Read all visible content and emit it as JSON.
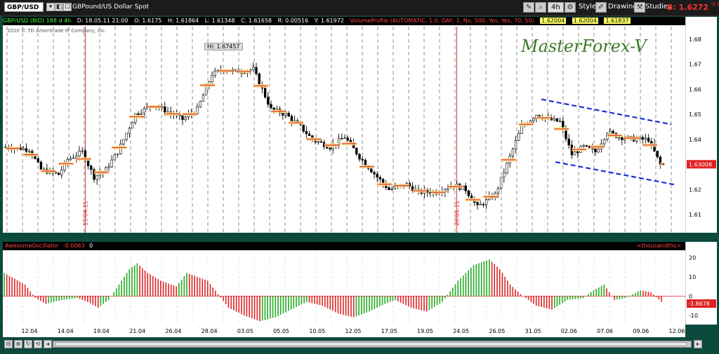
{
  "toolbar": {
    "symbol": "GBP/USD",
    "description": "GBPound/US Dollar Spot",
    "timeframe": "4h",
    "style_label": "Style",
    "drawings_label": "Drawings",
    "studies_label": "Studies",
    "bid_text": "B: 1.6272",
    "change_text": "-0.0"
  },
  "info_bar": {
    "title": "GBP/USD (BID) 188 d 4h",
    "date": "D: 18.05.11 21:00",
    "open": "O: 1.6175",
    "high": "H: 1.61864",
    "low": "L: 1.61348",
    "close": "C: 1.61658",
    "range": "R: 0.00516",
    "y": "Y: 1.61972",
    "study": "VolumeProfile (AUTOMATIC, 1.0, DAY, 1, No, 500, Yes, Yes, 70, 50)",
    "vals": [
      "1.62004",
      "1.62004",
      "1.61837"
    ]
  },
  "copyright": "2010 © TD Ameritrade IP Company, Inc.",
  "watermark": "MasterForex-V",
  "hi_label": "Hi: 1.67457",
  "markers": [
    "15.04.11",
    "20.05.11"
  ],
  "last_price": "1.63008",
  "oscillator": {
    "name": "AwesomeOscillator",
    "value": "-0.0063",
    "extra": "0",
    "units": "<thousandths>",
    "last_value": "-3.8678"
  },
  "colors": {
    "up_bar": "#22aa22",
    "down_bar": "#dd2222",
    "candle": "#000000",
    "channel": "#1a2fd8",
    "marker_line": "#dd2222",
    "watermark": "#3d7a28"
  },
  "chart_data": [
    {
      "type": "candlestick",
      "title": "GBP/USD (BID) 188 d 4h",
      "ylim": [
        1.605,
        1.685
      ],
      "yticks": [
        1.61,
        1.62,
        1.63,
        1.64,
        1.65,
        1.66,
        1.67,
        1.68
      ],
      "ytick_labels": [
        "1.61",
        "1.62",
        "1.63",
        "1.64",
        "1.65",
        "1.66",
        "1.67",
        "1.68"
      ],
      "x_labels": [
        "12.04",
        "14.04",
        "19.04",
        "21.04",
        "26.04",
        "28.04",
        "03.05",
        "05.05",
        "10.05",
        "12.05",
        "17.05",
        "19.05",
        "24.05",
        "26.05",
        "31.05",
        "02.06",
        "07.06",
        "09.06",
        "12.06"
      ],
      "path": [
        [
          0,
          1.637
        ],
        [
          8,
          1.636
        ],
        [
          12,
          1.628
        ],
        [
          18,
          1.626
        ],
        [
          21,
          1.632
        ],
        [
          26,
          1.635
        ],
        [
          30,
          1.625
        ],
        [
          34,
          1.628
        ],
        [
          38,
          1.635
        ],
        [
          44,
          1.65
        ],
        [
          50,
          1.654
        ],
        [
          55,
          1.651
        ],
        [
          60,
          1.648
        ],
        [
          65,
          1.652
        ],
        [
          70,
          1.666
        ],
        [
          74,
          1.668
        ],
        [
          78,
          1.667
        ],
        [
          84,
          1.668
        ],
        [
          90,
          1.652
        ],
        [
          95,
          1.65
        ],
        [
          100,
          1.645
        ],
        [
          104,
          1.64
        ],
        [
          110,
          1.637
        ],
        [
          115,
          1.641
        ],
        [
          120,
          1.633
        ],
        [
          126,
          1.625
        ],
        [
          130,
          1.62
        ],
        [
          136,
          1.622
        ],
        [
          140,
          1.619
        ],
        [
          146,
          1.619
        ],
        [
          152,
          1.622
        ],
        [
          156,
          1.62
        ],
        [
          160,
          1.613
        ],
        [
          166,
          1.618
        ],
        [
          170,
          1.63
        ],
        [
          175,
          1.645
        ],
        [
          180,
          1.65
        ],
        [
          184,
          1.648
        ],
        [
          188,
          1.647
        ],
        [
          192,
          1.634
        ],
        [
          196,
          1.637
        ],
        [
          200,
          1.635
        ],
        [
          204,
          1.643
        ],
        [
          208,
          1.641
        ],
        [
          214,
          1.64
        ],
        [
          218,
          1.64
        ],
        [
          222,
          1.63
        ]
      ],
      "highest": 1.67457,
      "last": 1.63008
    },
    {
      "type": "bar",
      "title": "AwesomeOscillator",
      "ylim": [
        -14,
        23
      ],
      "yticks": [
        20,
        10,
        0,
        -10
      ],
      "ytick_labels": [
        "20",
        "10",
        "0",
        "-10"
      ],
      "ao_path": [
        [
          0,
          12
        ],
        [
          8,
          6
        ],
        [
          12,
          -1
        ],
        [
          16,
          -4
        ],
        [
          22,
          -2
        ],
        [
          28,
          -1
        ],
        [
          32,
          -3
        ],
        [
          36,
          -6
        ],
        [
          40,
          -2
        ],
        [
          44,
          6
        ],
        [
          48,
          14
        ],
        [
          51,
          17
        ],
        [
          55,
          12
        ],
        [
          60,
          8
        ],
        [
          66,
          5
        ],
        [
          70,
          12
        ],
        [
          74,
          10
        ],
        [
          78,
          8
        ],
        [
          82,
          1
        ],
        [
          86,
          -6
        ],
        [
          92,
          -10
        ],
        [
          98,
          -13
        ],
        [
          104,
          -11
        ],
        [
          110,
          -7
        ],
        [
          116,
          -3
        ],
        [
          122,
          -5
        ],
        [
          128,
          -9
        ],
        [
          134,
          -11
        ],
        [
          140,
          -8
        ],
        [
          146,
          -4
        ],
        [
          150,
          -2
        ],
        [
          156,
          -6
        ],
        [
          162,
          -8
        ],
        [
          168,
          -3
        ],
        [
          174,
          8
        ],
        [
          180,
          16
        ],
        [
          186,
          19
        ],
        [
          190,
          14
        ],
        [
          194,
          6
        ],
        [
          198,
          1
        ],
        [
          204,
          -5
        ],
        [
          210,
          -7
        ],
        [
          216,
          -2
        ],
        [
          222,
          -1
        ],
        [
          226,
          3
        ],
        [
          230,
          6
        ],
        [
          234,
          -2
        ],
        [
          238,
          -1
        ],
        [
          244,
          3
        ],
        [
          248,
          2
        ],
        [
          252,
          -3
        ]
      ]
    }
  ]
}
